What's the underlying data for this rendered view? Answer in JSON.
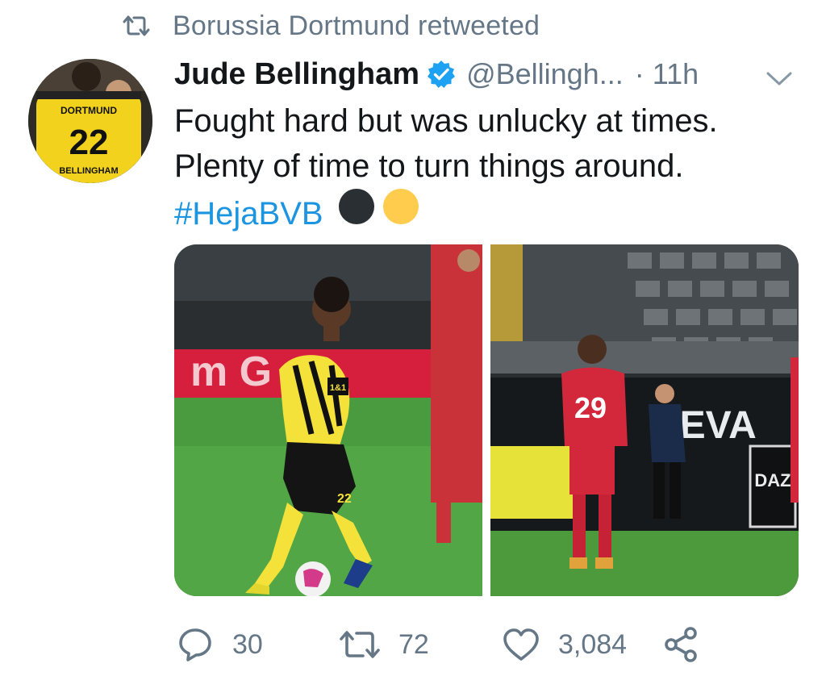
{
  "retweet_context": {
    "icon": "retweet-icon",
    "label": "Borussia Dortmund retweeted"
  },
  "author": {
    "name": "Jude Bellingham",
    "verified": true,
    "handle": "@Bellingh...",
    "separator": "·",
    "time": "11h",
    "avatar_jersey_text": "DORTMUND",
    "avatar_jersey_number": "22",
    "avatar_jersey_name": "BELLINGHAM"
  },
  "tweet": {
    "line1": "Fought hard but was unlucky at times.",
    "line2": "Plenty of time to turn things around.",
    "hashtag": "#HejaBVB",
    "emojis": [
      "black-circle",
      "yellow-circle"
    ]
  },
  "media": [
    {
      "kind": "photo",
      "subject": "player-in-yellow-black-kit",
      "shirt_number": "22",
      "sponsor": "1&1",
      "board_text": "m G"
    },
    {
      "kind": "photo",
      "subject": "player-in-red-kit",
      "shirt_number": "29",
      "board_text": "DEVA",
      "side_logo": "DAZ"
    }
  ],
  "actions": {
    "reply_count": "30",
    "retweet_count": "72",
    "like_count": "3,084"
  },
  "colors": {
    "text_primary": "#14171a",
    "text_secondary": "#657786",
    "link": "#1b95e0",
    "verified": "#1da1f2"
  }
}
